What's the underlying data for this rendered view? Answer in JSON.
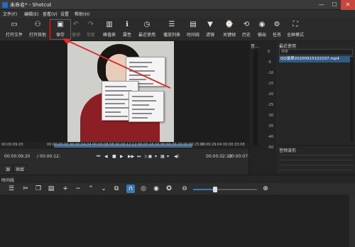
{
  "window": {
    "title": "未命名* - Shotcut",
    "min": "—",
    "max": "☐",
    "close": "✕"
  },
  "menu": [
    "文件(F)",
    "编辑(E)",
    "查看(V)",
    "设置",
    "帮助(H)"
  ],
  "toolbar": [
    {
      "label": "打开文件",
      "icon": "folder-icon",
      "glyph": "▭",
      "disabled": false
    },
    {
      "label": "打开其他",
      "icon": "open-other-icon",
      "glyph": "⚇",
      "disabled": false
    },
    {
      "label": "保存",
      "icon": "save-icon",
      "glyph": "▣",
      "disabled": false
    },
    {
      "label": "撤销",
      "icon": "undo-icon",
      "glyph": "↶",
      "disabled": true
    },
    {
      "label": "恢复",
      "icon": "redo-icon",
      "glyph": "↷",
      "disabled": true
    },
    {
      "label": "峰值表",
      "icon": "peak-meter-icon",
      "glyph": "▥",
      "disabled": false
    },
    {
      "label": "属性",
      "icon": "info-icon",
      "glyph": "ℹ",
      "disabled": false
    },
    {
      "label": "最近使用",
      "icon": "clock-icon",
      "glyph": "◷",
      "disabled": false
    },
    {
      "label": "播放列表",
      "icon": "playlist-icon",
      "glyph": "☰",
      "disabled": false
    },
    {
      "label": "时间线",
      "icon": "timeline-icon",
      "glyph": "▤",
      "disabled": false
    },
    {
      "label": "滤镜",
      "icon": "filter-icon",
      "glyph": "▼",
      "disabled": false
    },
    {
      "label": "关键帧",
      "icon": "keyframe-icon",
      "glyph": "⌚",
      "disabled": false
    },
    {
      "label": "历史",
      "icon": "history-icon",
      "glyph": "⟲",
      "disabled": false
    },
    {
      "label": "输出",
      "icon": "export-icon",
      "glyph": "◉",
      "disabled": false
    },
    {
      "label": "任务",
      "icon": "jobs-icon",
      "glyph": "⚙",
      "disabled": false
    },
    {
      "label": "全屏模式",
      "icon": "fullscreen-icon",
      "glyph": "⛶",
      "disabled": false
    }
  ],
  "player": {
    "ruler_ticks": [
      "00:00:09:20",
      "00:00:00:00",
      "00:00:04:04",
      "00:00:08:08",
      "00:00:12:12",
      "00:00:16:16",
      "00:00:20:20",
      "00:00:25:00",
      "00:00:29:04",
      "00:00:33:08"
    ],
    "position": "00:00:09:20",
    "duration": "/ 00:00:12:",
    "in_point": "00:00:02:12",
    "out_point": "00:00:07:0",
    "transport": [
      "⏮",
      "◀",
      "■",
      "▶",
      "▶▶",
      "⏭",
      "▷▣",
      "▾",
      "▦",
      "▾",
      "◀)"
    ],
    "tabs": [
      "源",
      "项目"
    ]
  },
  "meter": {
    "title": "音…",
    "scale": [
      "0",
      "-5",
      "-10",
      "-15",
      "-20",
      "-25",
      "-30",
      "-35",
      "-40",
      "-50"
    ]
  },
  "recent": {
    "title": "最近使用",
    "search_placeholder": "搜索",
    "items": [
      "QQ录屏20200915102107.mp4"
    ]
  },
  "keyframes": {
    "title": "音频波形"
  },
  "timeline": {
    "title": "时间线",
    "tools": [
      {
        "icon": "menu-icon",
        "glyph": "☰"
      },
      {
        "icon": "cut-icon",
        "glyph": "✂"
      },
      {
        "icon": "copy-icon",
        "glyph": "❐"
      },
      {
        "icon": "paste-icon",
        "glyph": "▤"
      },
      {
        "icon": "append-icon",
        "glyph": "+"
      },
      {
        "icon": "remove-icon",
        "glyph": "−"
      },
      {
        "icon": "lift-icon",
        "glyph": "⌃"
      },
      {
        "icon": "overwrite-icon",
        "glyph": "⌄"
      },
      {
        "icon": "split-icon",
        "glyph": "⧉"
      },
      {
        "icon": "snap-icon",
        "glyph": "∩"
      },
      {
        "icon": "scrub-icon",
        "glyph": "◎"
      },
      {
        "icon": "ripple-icon",
        "glyph": "◉"
      },
      {
        "icon": "ripple-all-icon",
        "glyph": "✪"
      },
      {
        "icon": "zoom-out-icon",
        "glyph": "⊖"
      },
      {
        "icon": "zoom-in-icon",
        "glyph": "⊕"
      }
    ]
  }
}
